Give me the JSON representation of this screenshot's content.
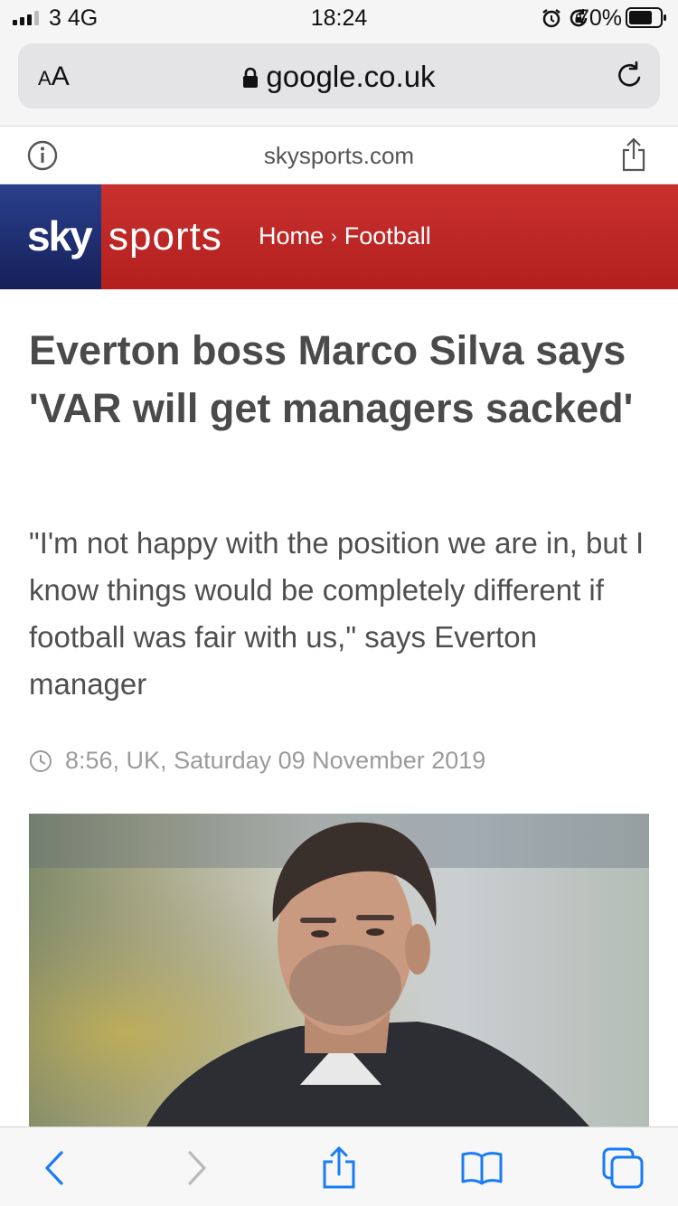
{
  "status_bar": {
    "carrier": "3 4G",
    "time": "18:24",
    "battery": "70%"
  },
  "browser": {
    "text_size_small": "A",
    "text_size_large": "A",
    "address": "google.co.uk"
  },
  "site_bar": {
    "domain": "skysports.com"
  },
  "header": {
    "logo_sky": "sky",
    "logo_sports": "sports",
    "breadcrumb": [
      "Home",
      "Football"
    ],
    "breadcrumb_separator": "›",
    "brand_red": "#c32b2a",
    "brand_blue": "#1e2b6e"
  },
  "article": {
    "headline": "Everton boss Marco Silva says 'VAR will get managers sacked'",
    "standfirst": "\"I'm not happy with the position we are in, but I know things would be completely different if football was fair with us,\" says Everton manager",
    "timestamp": "8:56, UK, Saturday 09 November 2019"
  },
  "icons": {
    "status": [
      "signal-icon",
      "alarm-icon",
      "rotation-lock-icon",
      "battery-icon"
    ],
    "url_bar": [
      "lock-icon",
      "reload-icon"
    ],
    "site_bar": [
      "info-icon",
      "share-icon"
    ],
    "toolbar": [
      "back-icon",
      "forward-icon",
      "share-icon",
      "bookmarks-icon",
      "tabs-icon"
    ]
  }
}
